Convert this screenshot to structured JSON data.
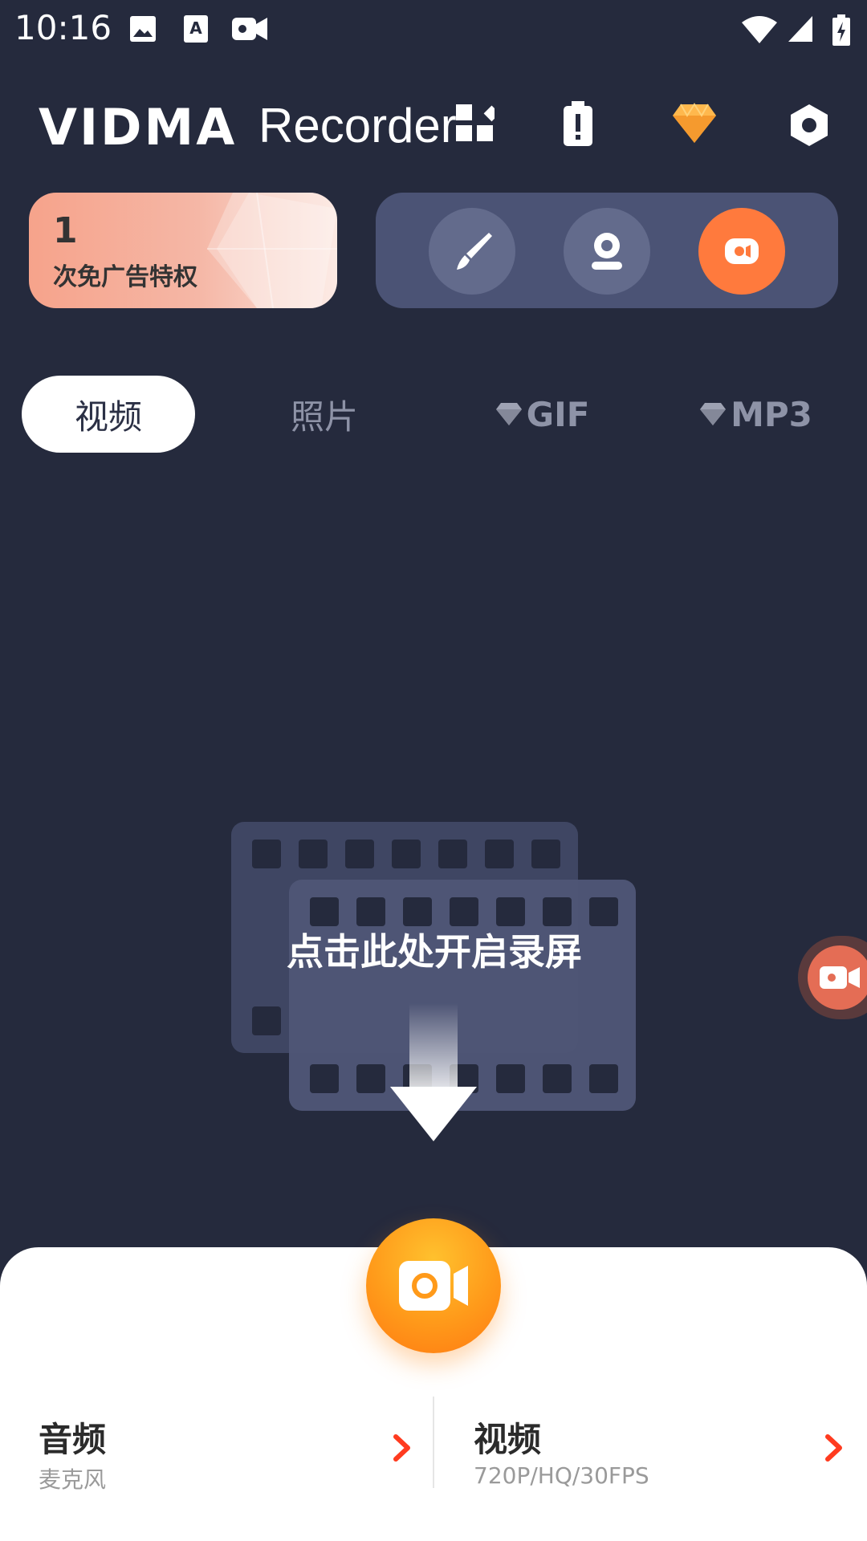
{
  "status_bar": {
    "time": "10:16",
    "left_icons": [
      "image-icon",
      "text-a-icon",
      "video-camera-icon"
    ],
    "right_icons": [
      "wifi-icon",
      "cell-signal-icon",
      "battery-icon"
    ]
  },
  "header": {
    "logo_text": "VIDMA",
    "logo_subtext": "Recorder",
    "icons": [
      "apps-icon",
      "battery-alert-icon",
      "diamond-icon",
      "settings-hex-icon"
    ],
    "accent_color": "#ffb84d"
  },
  "promo": {
    "count": "1",
    "text": "次免广告特权"
  },
  "tools": {
    "items": [
      "brush-icon",
      "facecam-icon",
      "record-dot-icon"
    ],
    "active_color": "#ff7a3d"
  },
  "tabs": [
    {
      "label": "视频",
      "active": true
    },
    {
      "label": "照片",
      "active": false
    },
    {
      "label": "GIF",
      "premium": true,
      "active": false
    },
    {
      "label": "MP3",
      "premium": true,
      "active": false
    }
  ],
  "empty_state": {
    "hint": "点击此处开启录屏"
  },
  "bottom": {
    "audio_title": "音频",
    "audio_sub": "麦克风",
    "video_title": "视频",
    "video_sub": "720P/HQ/30FPS",
    "arrow_color": "#ff3b1f",
    "record_color": "#ff9a1a"
  }
}
